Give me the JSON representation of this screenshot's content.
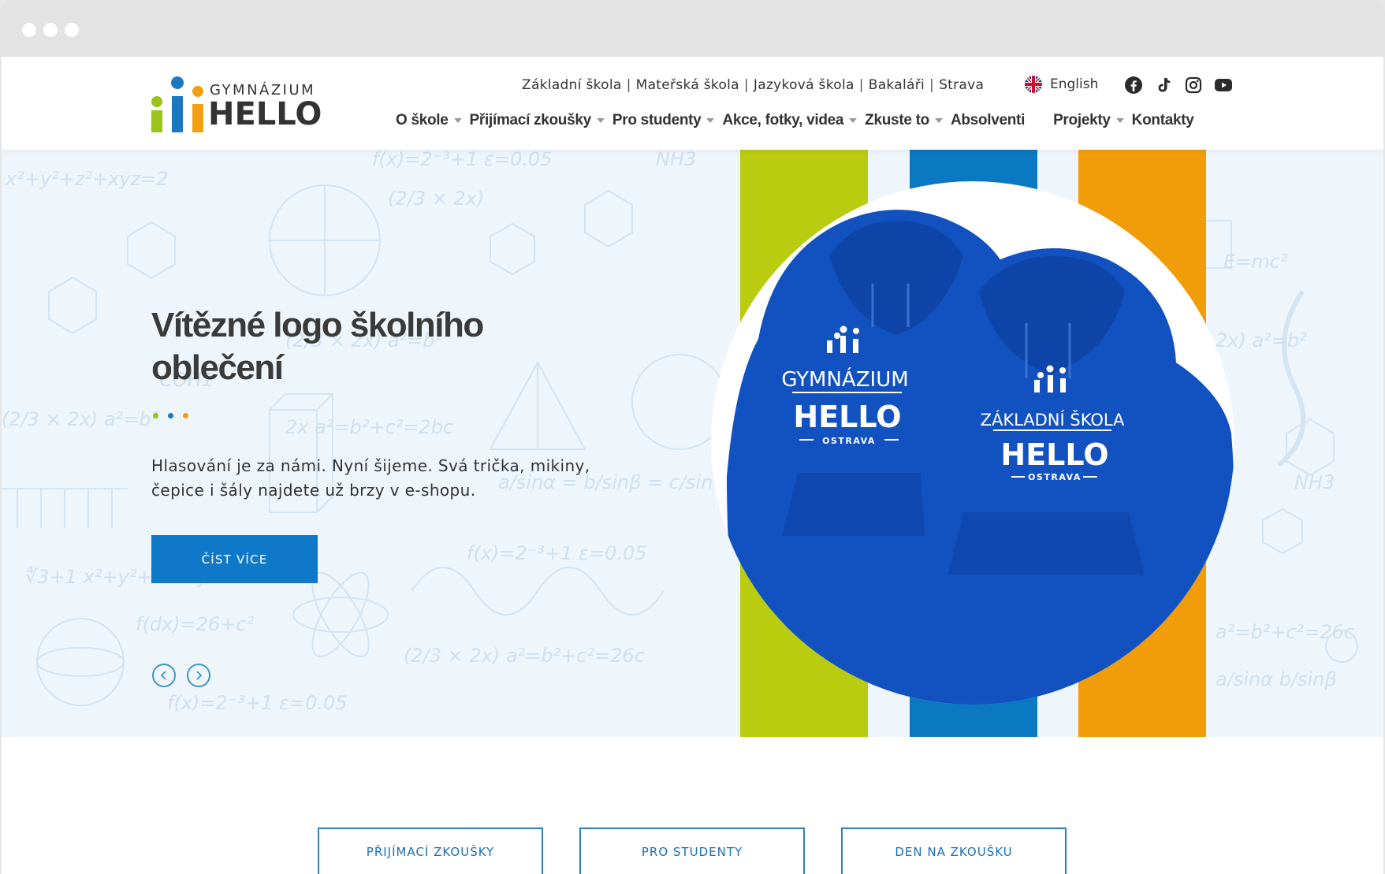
{
  "school": {
    "logo_small": "GYMNÁZIUM",
    "logo_big": "HELLO"
  },
  "top_links": [
    "Základní škola",
    "Mateřská škola",
    "Jazyková škola",
    "Bakaláři",
    "Strava"
  ],
  "language": "English",
  "socials": [
    "facebook-icon",
    "tiktok-icon",
    "instagram-icon",
    "youtube-icon"
  ],
  "nav": [
    {
      "label": "O škole",
      "dropdown": true
    },
    {
      "label": "Přijímací zkoušky",
      "dropdown": true
    },
    {
      "label": "Pro studenty",
      "dropdown": true
    },
    {
      "label": "Akce, fotky, videa",
      "dropdown": true
    },
    {
      "label": "Zkuste to",
      "dropdown": true
    },
    {
      "label": "Absolventi",
      "dropdown": false
    },
    {
      "label": "Projekty",
      "dropdown": true
    },
    {
      "label": "Kontakty",
      "dropdown": false
    }
  ],
  "hero": {
    "title": "Vítězné logo školního oblečení",
    "text": "Hlasování je za námi. Nyní šijeme. Svá trička, mikiny, čepice i šály najdete už brzy v e-shopu.",
    "button": "ČÍST VÍCE",
    "dot_colors": [
      "#9bc41a",
      "#1a78c2",
      "#f0a012"
    ],
    "stripe_colors": [
      "#b9cc10",
      "#0b78c2",
      "#f19d0a"
    ],
    "hoodie_left": {
      "line1": "GYMNÁZIUM",
      "line2": "HELLO",
      "line3": "OSTRAVA"
    },
    "hoodie_right": {
      "line1": "ZÁKLADNÍ ŠKOLA",
      "line2": "HELLO",
      "line3": "OSTRAVA"
    }
  },
  "bottom_buttons": [
    "PŘIJÍMACÍ ZKOUŠKY",
    "PRO STUDENTY",
    "DEN NA ZKOUŠKU"
  ]
}
